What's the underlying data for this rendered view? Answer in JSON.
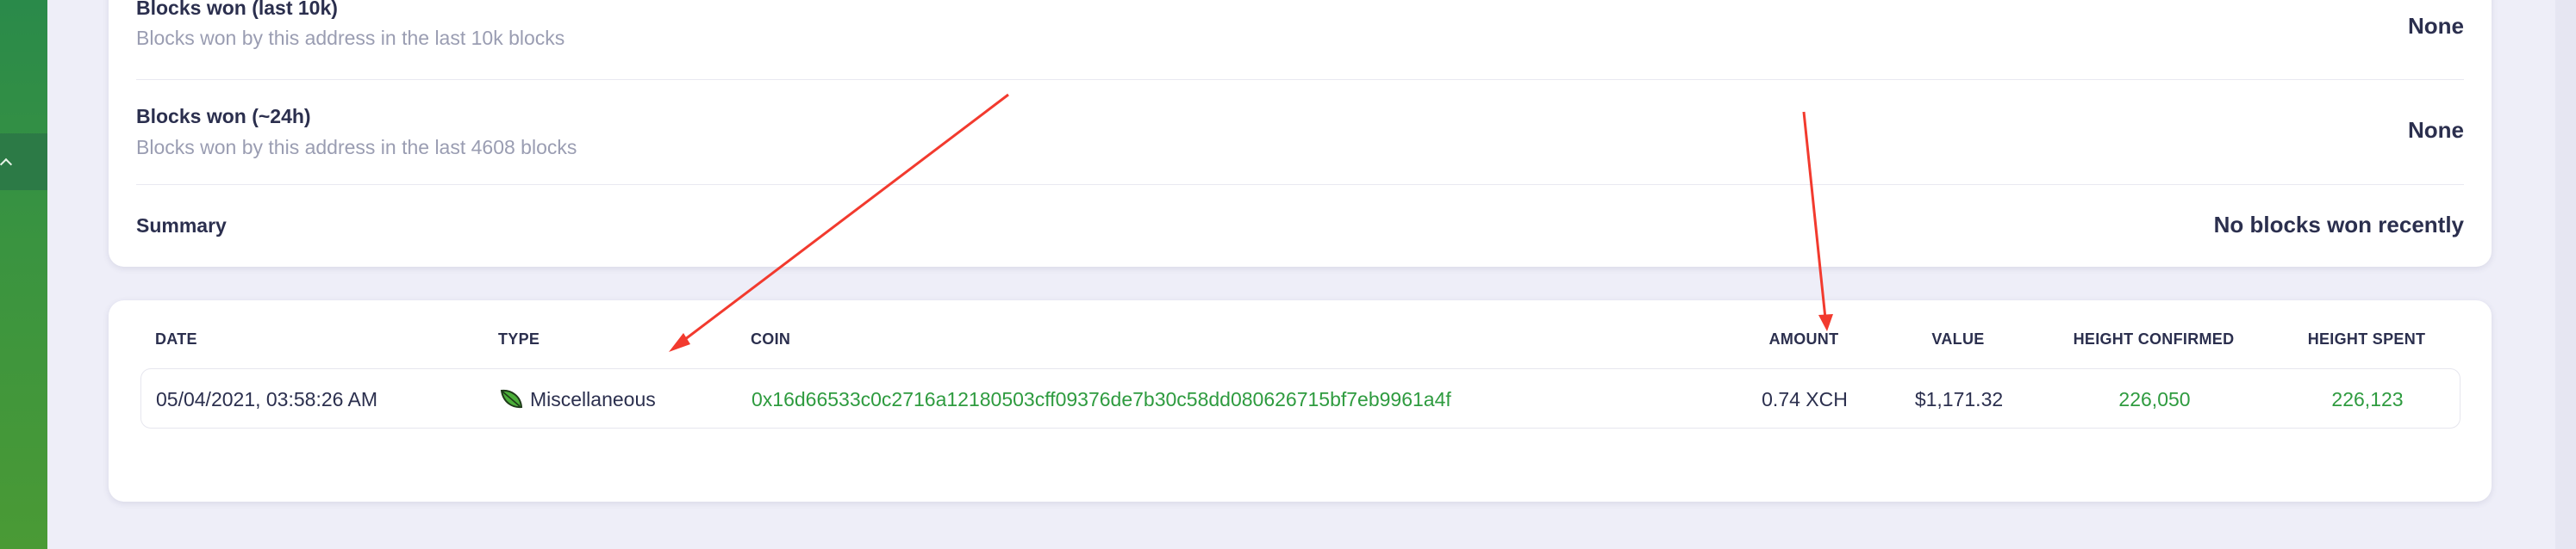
{
  "sidebar": {
    "toggle_icon": "chevron-up-icon"
  },
  "stats": [
    {
      "title": "Blocks won (last 10k)",
      "description": "Blocks won by this address in the last 10k blocks",
      "value": "None"
    },
    {
      "title": "Blocks won (~24h)",
      "description": "Blocks won by this address in the last 4608 blocks",
      "value": "None"
    },
    {
      "title": "Summary",
      "description": "",
      "value": "No blocks won recently"
    }
  ],
  "coin_table": {
    "headers": {
      "date": "DATE",
      "type": "TYPE",
      "coin": "COIN",
      "amount": "AMOUNT",
      "value": "VALUE",
      "height_confirmed": "HEIGHT CONFIRMED",
      "height_spent": "HEIGHT SPENT"
    },
    "rows": [
      {
        "date": "05/04/2021, 03:58:26 AM",
        "type_icon": "leaf-icon",
        "type": "Miscellaneous",
        "coin": "0x16d66533c0c2716a12180503cff09376de7b30c58dd080626715bf7eb9961a4f",
        "amount": "0.74 XCH",
        "value": "$1,171.32",
        "height_confirmed": "226,050",
        "height_spent": "226,123"
      }
    ]
  },
  "colors": {
    "link_green": "#2e9b3f",
    "annotation_red": "#f23a2e",
    "sidebar_green": "#3a9440"
  }
}
